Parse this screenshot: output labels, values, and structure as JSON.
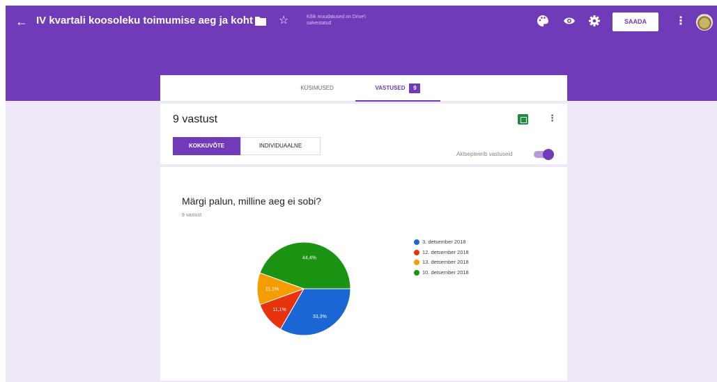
{
  "header": {
    "title": "IV kvartali koosoleku toimumise aeg ja koht",
    "saved_note": "Kõik muudatused on Drive'i salvestatud",
    "send_label": "SAADA",
    "colors": {
      "primary": "#6f3bb8",
      "background": "#efe9f7"
    }
  },
  "tabs": {
    "questions_label": "KÜSIMUSED",
    "responses_label": "VASTUSED",
    "responses_badge": "9"
  },
  "summary": {
    "count_text": "9 vastust",
    "summary_label": "KOKKUVÕTE",
    "individual_label": "INDIVIDUAALNE",
    "accepting_label": "Aktsepteerib vastuseid",
    "accepting": true
  },
  "question": {
    "title": "Märgi palun, milline aeg ei sobi?",
    "count_text": "9 vastust"
  },
  "chart_data": {
    "type": "pie",
    "categories": [
      "3. detsember 2018",
      "12. detsember 2018",
      "13. detsember 2018",
      "10. detsember 2018"
    ],
    "values": [
      33.3,
      11.1,
      11.1,
      44.4
    ],
    "labels": [
      "33,3%",
      "11,1%",
      "11,1%",
      "44,4%"
    ],
    "colors": [
      "#1a66d4",
      "#e8330c",
      "#f59d00",
      "#1c9413"
    ],
    "legend_position": "right"
  }
}
